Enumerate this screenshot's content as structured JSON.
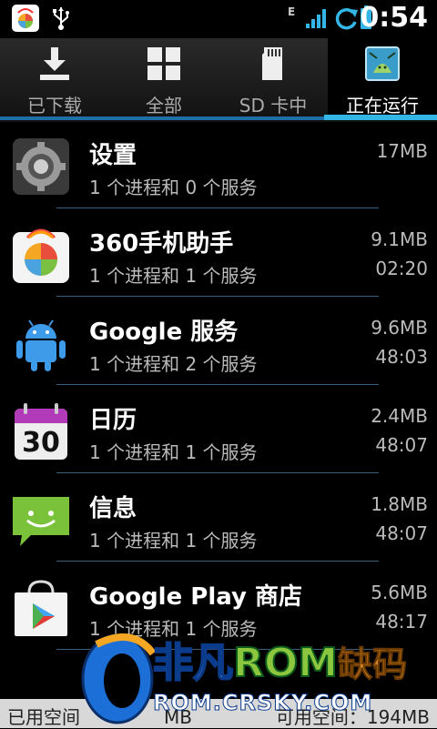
{
  "status_bar": {
    "network_type": "E",
    "time": "0:54",
    "icons": [
      "app-store-icon",
      "usb-icon",
      "signal-icon",
      "sync-icon",
      "battery-icon"
    ]
  },
  "tabs": [
    {
      "label": "已下载",
      "icon": "download-icon",
      "active": false
    },
    {
      "label": "全部",
      "icon": "grid-icon",
      "active": false
    },
    {
      "label": "SD 卡中",
      "icon": "sd-card-icon",
      "active": false
    },
    {
      "label": "正在运行",
      "icon": "running-apps-icon",
      "active": true
    }
  ],
  "accent_color": "#33b5e5",
  "apps": [
    {
      "name": "设置",
      "detail": "1 个进程和 0 个服务",
      "size": "17MB",
      "time": "",
      "icon": "settings-gear-icon"
    },
    {
      "name": "360手机助手",
      "detail": "1 个进程和 1 个服务",
      "size": "9.1MB",
      "time": "02:20",
      "icon": "360-assistant-icon"
    },
    {
      "name": "Google 服务",
      "detail": "1 个进程和 2 个服务",
      "size": "9.6MB",
      "time": "48:03",
      "icon": "android-robot-icon"
    },
    {
      "name": "日历",
      "detail": "1 个进程和 1 个服务",
      "size": "2.4MB",
      "time": "48:07",
      "icon": "calendar-icon"
    },
    {
      "name": "信息",
      "detail": "1 个进程和 1 个服务",
      "size": "1.8MB",
      "time": "48:07",
      "icon": "messaging-icon"
    },
    {
      "name": "Google Play 商店",
      "detail": "1 个进程和 1 个服务",
      "size": "5.6MB",
      "time": "48:17",
      "icon": "play-store-icon"
    }
  ],
  "calendar_day": "30",
  "storage": {
    "used_label": "已用空间",
    "used_value": "MB",
    "free_label": "可用空间：",
    "free_value": "194MB"
  },
  "watermark": {
    "brand_cn": "非凡",
    "brand_rom": "ROM",
    "brand_tail": "缺码",
    "url": "ROM.CRSKY.COM"
  }
}
